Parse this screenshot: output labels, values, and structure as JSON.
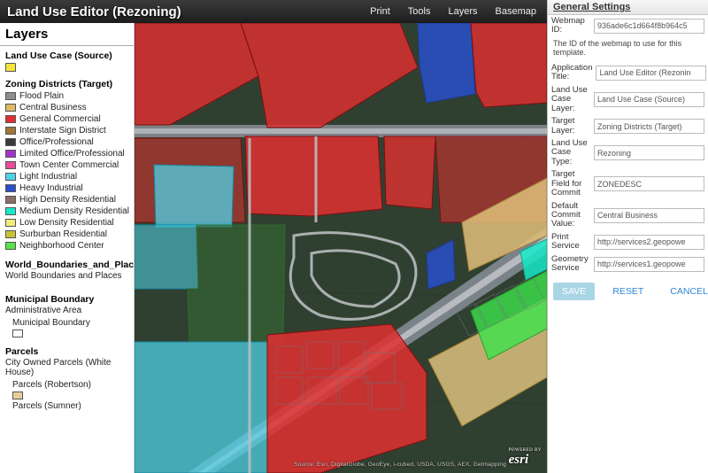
{
  "header": {
    "title": "Land Use Editor (Rezoning)",
    "menu": [
      "Print",
      "Tools",
      "Layers",
      "Basemap"
    ]
  },
  "layers_panel": {
    "title": "Layers",
    "source_group": {
      "title": "Land Use Case (Source)",
      "swatch_color": "#f5e53b"
    },
    "target_group": {
      "title": "Zoning Districts (Target)",
      "items": [
        {
          "color": "#8e8e8e",
          "label": "Flood Plain"
        },
        {
          "color": "#dcb966",
          "label": "Central Business"
        },
        {
          "color": "#e03030",
          "label": "General Commercial"
        },
        {
          "color": "#a07538",
          "label": "Interstate Sign District"
        },
        {
          "color": "#3a3a36",
          "label": "Office/Professional"
        },
        {
          "color": "#a233c9",
          "label": "Limited Office/Professional"
        },
        {
          "color": "#e64c9a",
          "label": "Town Center Commercial"
        },
        {
          "color": "#4fd2e8",
          "label": "Light Industrial"
        },
        {
          "color": "#2850c9",
          "label": "Heavy Industrial"
        },
        {
          "color": "#8a6e63",
          "label": "High Density Residential"
        },
        {
          "color": "#15e9c7",
          "label": "Medium Density Residential"
        },
        {
          "color": "#f3ec79",
          "label": "Low Density Residential"
        },
        {
          "color": "#c6c335",
          "label": "Surburban Residential"
        },
        {
          "color": "#59e24c",
          "label": "Neighborhood Center"
        }
      ]
    },
    "boundaries_group": {
      "title": "World_Boundaries_and_Places",
      "sub": "World Boundaries and Places"
    },
    "muni_group": {
      "title": "Municipal Boundary",
      "sub1": "Administrative Area",
      "sub2": "Municipal Boundary"
    },
    "parcels_group": {
      "title": "Parcels",
      "sub1": "City Owned Parcels (White House)",
      "sub2": "Parcels (Robertson)",
      "sub3": "Parcels (Sumner)"
    }
  },
  "settings": {
    "title": "General Settings",
    "fields": {
      "webmap_id": {
        "label": "Webmap ID:",
        "value": "936ade6c1d664f8b964c5"
      },
      "desc": "The ID of the webmap to use for this template.",
      "app_title": {
        "label": "Application Title:",
        "value": "Land Use Editor (Rezonin"
      },
      "luc_layer": {
        "label": "Land Use Case Layer:",
        "value": "Land Use Case (Source)"
      },
      "target_layer": {
        "label": "Target Layer:",
        "value": "Zoning Districts (Target)"
      },
      "luc_type": {
        "label": "Land Use Case Type:",
        "value": "Rezoning"
      },
      "target_field": {
        "label": "Target Field for Commit",
        "value": "ZONEDESC"
      },
      "default_commit": {
        "label": "Default Commit Value:",
        "value": "Central Business"
      },
      "print_service": {
        "label": "Print Service",
        "value": "http://services2.geopowe"
      },
      "geom_service": {
        "label": "Geometry Service",
        "value": "http://services1.geopowe"
      }
    },
    "buttons": {
      "save": "SAVE",
      "reset": "RESET",
      "cancel": "CANCEL"
    }
  },
  "map": {
    "attribution": "Source: Esri, DigitalGlobe, GeoEye, i-cubed, USDA, USGS, AEX, Getmapping",
    "logo": "esri",
    "logo_tag": "POWERED BY"
  }
}
